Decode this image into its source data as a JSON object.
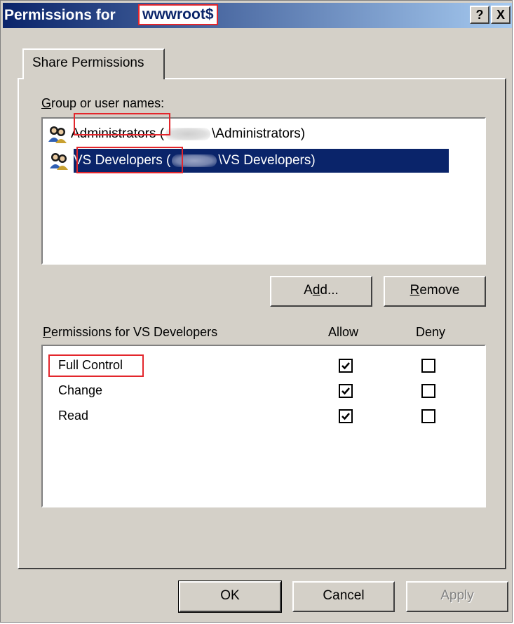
{
  "window": {
    "title_prefix": "Permissions for ",
    "title_name": "wwwroot$",
    "help_button": "?",
    "close_button": "X"
  },
  "tab": {
    "label": "Share Permissions"
  },
  "group_section": {
    "label": "Group or user names:",
    "users": [
      {
        "name": "Administrators",
        "detail_prefix": " (",
        "detail_suffix": "\\Administrators)",
        "selected": false
      },
      {
        "name": "VS Developers",
        "detail_prefix": " (",
        "detail_suffix": "\\VS Developers)",
        "selected": true
      }
    ]
  },
  "buttons": {
    "add": "Add...",
    "remove": "Remove",
    "ok": "OK",
    "cancel": "Cancel",
    "apply": "Apply"
  },
  "permissions": {
    "label": "Permissions for VS Developers",
    "allow_header": "Allow",
    "deny_header": "Deny",
    "rows": [
      {
        "name": "Full Control",
        "allow": true,
        "deny": false
      },
      {
        "name": "Change",
        "allow": true,
        "deny": false
      },
      {
        "name": "Read",
        "allow": true,
        "deny": false
      }
    ]
  },
  "colors": {
    "selection": "#0a246a",
    "highlight_box": "#e3262c",
    "face": "#d4d0c8"
  }
}
